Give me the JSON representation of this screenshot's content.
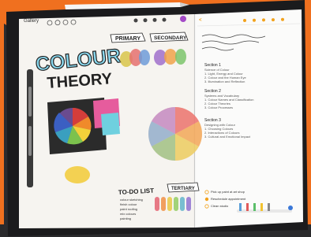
{
  "canvas_app": {
    "gallery_label": "Gallery",
    "title_colour": "COLOUR",
    "title_theory": "THEORY",
    "labels": {
      "primary": "PRIMARY",
      "secondary": "SECONDARY",
      "tertiary": "TERTIARY",
      "todo": "TO-DO LIST"
    },
    "todo_items": [
      "colour sketching",
      "finish colour",
      "paint roofing",
      "mix colours",
      "painting"
    ]
  },
  "notes_app": {
    "back_label": "<",
    "lines": [
      {
        "text": "Section 1",
        "head": true
      },
      {
        "text": "Science of Colour",
        "head": false
      },
      {
        "text": "1. Light, Energy and Colour",
        "head": false
      },
      {
        "text": "2. Colour and the Human Eye",
        "head": false
      },
      {
        "text": "3. Illumination and Reflection",
        "head": false
      },
      {
        "text": "Section 2",
        "head": true
      },
      {
        "text": "Systems and Vocabulary",
        "head": false
      },
      {
        "text": "1. Colour Names and Classification",
        "head": false
      },
      {
        "text": "2. Colour Theories",
        "head": false
      },
      {
        "text": "3. Colour Processes",
        "head": false
      },
      {
        "text": "Section 3",
        "head": true
      },
      {
        "text": "Designing with Colour",
        "head": false
      },
      {
        "text": "1. Choosing Colours",
        "head": false
      },
      {
        "text": "2. Interactions of Colours",
        "head": false
      },
      {
        "text": "3. Cultural and Emotional Impact",
        "head": false
      }
    ],
    "reminders": [
      "Pick up paint at art shop",
      "Reschedule appointment",
      "Clean studio"
    ]
  },
  "colors": {
    "background": "#f0701f",
    "frame": "#1b1b1d",
    "canvas": "#f6f4f0",
    "notes_accent": "#f2a21c"
  }
}
